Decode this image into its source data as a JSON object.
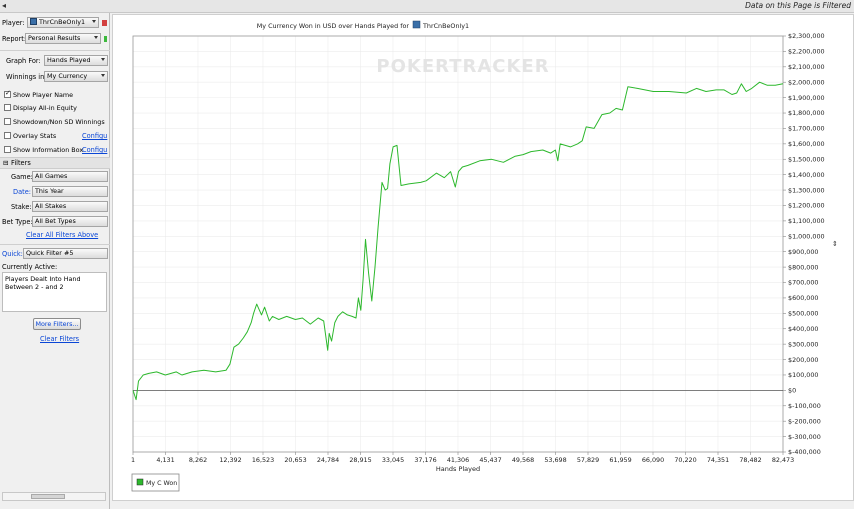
{
  "top_bar": {
    "collapse_icon": "◂",
    "filter_note": "Data on this Page is Filtered"
  },
  "sidebar": {
    "player_label": "Player:",
    "player_value": "ThrCnBeOnly1",
    "report_label": "Report:",
    "report_value": "Personal Results",
    "graph_for_label": "Graph For:",
    "graph_for_value": "Hands Played",
    "winnings_in_label": "Winnings in:",
    "winnings_in_value": "My Currency",
    "options": [
      {
        "label": "Show Player Name",
        "checked": true
      },
      {
        "label": "Display All-in Equity",
        "checked": false
      },
      {
        "label": "Showdown/Non SD Winnings",
        "checked": false
      },
      {
        "label": "Overlay Stats",
        "checked": false,
        "link": "Configu"
      },
      {
        "label": "Show Information Box",
        "checked": false,
        "link": "Configu"
      }
    ],
    "filters_header": "Filters",
    "game_label": "Game:",
    "game_value": "All Games",
    "date_label": "Date:",
    "date_value": "This Year",
    "stake_label": "Stake:",
    "stake_value": "All Stakes",
    "bet_type_label": "Bet Type:",
    "bet_type_value": "All Bet Types",
    "clear_all_link": "Clear All Filters Above",
    "quick_label": "Quick:",
    "quick_value": "Quick Filter #5",
    "currently_active_label": "Currently Active:",
    "active_filter_text": "Players Dealt Into Hand Between 2 - and 2",
    "more_filters_button": "More Filters...",
    "clear_filters_link": "Clear Filters"
  },
  "chart_data": {
    "type": "line",
    "title": "My Currency Won in USD over Hands Played for",
    "title_player": "ThrCnBeOnly1",
    "watermark": "POKERTRACKER",
    "xlabel": "Hands Played",
    "ylabel": "",
    "x_ticks": [
      "1",
      "4,131",
      "8,262",
      "12,392",
      "16,523",
      "20,653",
      "24,784",
      "28,915",
      "33,045",
      "37,176",
      "41,306",
      "45,437",
      "49,568",
      "53,698",
      "57,829",
      "61,959",
      "66,090",
      "70,220",
      "74,351",
      "78,482",
      "82,473"
    ],
    "y_ticks": [
      "$2,300,000",
      "$2,200,000",
      "$2,100,000",
      "$2,000,000",
      "$1,900,000",
      "$1,800,000",
      "$1,700,000",
      "$1,600,000",
      "$1,500,000",
      "$1,400,000",
      "$1,300,000",
      "$1,200,000",
      "$1,100,000",
      "$1,000,000",
      "$900,000",
      "$800,000",
      "$700,000",
      "$600,000",
      "$500,000",
      "$400,000",
      "$300,000",
      "$200,000",
      "$100,000",
      "$0",
      "$-100,000",
      "$-200,000",
      "$-300,000",
      "$-400,000"
    ],
    "xlim": [
      1,
      82473
    ],
    "ylim": [
      -400000,
      2300000
    ],
    "grid": true,
    "legend_position": "bottom-left",
    "series": [
      {
        "name": "My C Won",
        "color": "#2db82d",
        "x": [
          1,
          400,
          700,
          1300,
          2000,
          3000,
          4100,
          5500,
          6200,
          7500,
          9000,
          10500,
          11800,
          12300,
          12800,
          13400,
          14000,
          14500,
          15000,
          15300,
          15700,
          16300,
          16700,
          17300,
          17700,
          18500,
          19500,
          20600,
          21500,
          22500,
          23500,
          24200,
          24700,
          24900,
          25200,
          25600,
          26000,
          26600,
          27200,
          27800,
          28300,
          28600,
          28900,
          29200,
          29500,
          29900,
          30300,
          30700,
          31100,
          31600,
          32000,
          32300,
          32600,
          33000,
          33500,
          34000,
          35000,
          36500,
          37200,
          38500,
          39500,
          40300,
          40900,
          41300,
          41800,
          42500,
          44000,
          45500,
          47000,
          48500,
          49500,
          50500,
          52000,
          53000,
          53600,
          53900,
          54200,
          55500,
          56400,
          57000,
          57500,
          58500,
          59500,
          60500,
          61300,
          62100,
          62800,
          64000,
          66000,
          68000,
          70200,
          71500,
          72700,
          74000,
          75000,
          76000,
          76600,
          77200,
          77800,
          78500,
          79500,
          80500,
          81500,
          82473
        ],
        "y": [
          0,
          -60000,
          60000,
          100000,
          110000,
          120000,
          100000,
          120000,
          100000,
          120000,
          130000,
          120000,
          130000,
          170000,
          280000,
          300000,
          340000,
          380000,
          440000,
          500000,
          560000,
          490000,
          540000,
          450000,
          480000,
          460000,
          480000,
          460000,
          470000,
          430000,
          470000,
          450000,
          260000,
          370000,
          320000,
          440000,
          480000,
          510000,
          490000,
          480000,
          470000,
          600000,
          520000,
          720000,
          980000,
          760000,
          580000,
          800000,
          1060000,
          1350000,
          1300000,
          1310000,
          1470000,
          1580000,
          1590000,
          1330000,
          1340000,
          1350000,
          1360000,
          1410000,
          1380000,
          1420000,
          1320000,
          1420000,
          1450000,
          1460000,
          1490000,
          1500000,
          1480000,
          1520000,
          1530000,
          1550000,
          1560000,
          1540000,
          1560000,
          1490000,
          1600000,
          1580000,
          1600000,
          1620000,
          1710000,
          1700000,
          1790000,
          1800000,
          1830000,
          1820000,
          1970000,
          1960000,
          1940000,
          1940000,
          1930000,
          1960000,
          1940000,
          1950000,
          1950000,
          1920000,
          1930000,
          1990000,
          1940000,
          1960000,
          2000000,
          1980000,
          1980000,
          1990000
        ]
      }
    ]
  }
}
